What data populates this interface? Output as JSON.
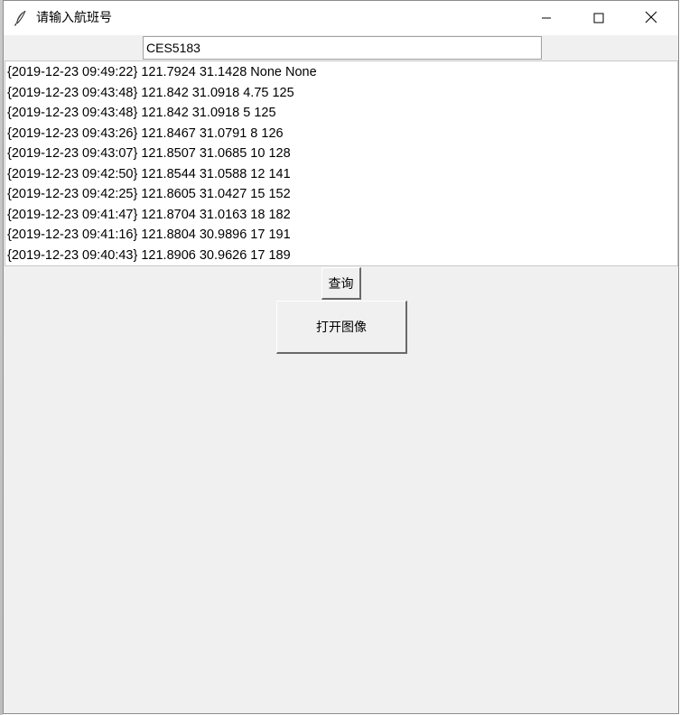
{
  "window": {
    "title": "请输入航班号",
    "icon": "feather-icon",
    "controls": {
      "minimize": "minimize-icon",
      "maximize": "maximize-icon",
      "close": "close-icon"
    }
  },
  "flight_input": {
    "value": "CES5183"
  },
  "results": [
    "{2019-12-23 09:49:22} 121.7924 31.1428 None None",
    "{2019-12-23 09:43:48} 121.842 31.0918 4.75 125",
    "{2019-12-23 09:43:48} 121.842 31.0918 5 125",
    "{2019-12-23 09:43:26} 121.8467 31.0791 8 126",
    "{2019-12-23 09:43:07} 121.8507 31.0685 10 128",
    "{2019-12-23 09:42:50} 121.8544 31.0588 12 141",
    "{2019-12-23 09:42:25} 121.8605 31.0427 15 152",
    "{2019-12-23 09:41:47} 121.8704 31.0163 18 182",
    "{2019-12-23 09:41:16} 121.8804 30.9896 17 191",
    "{2019-12-23 09:40:43} 121.8906 30.9626 17 189"
  ],
  "buttons": {
    "query": "查询",
    "open_image": "打开图像"
  }
}
